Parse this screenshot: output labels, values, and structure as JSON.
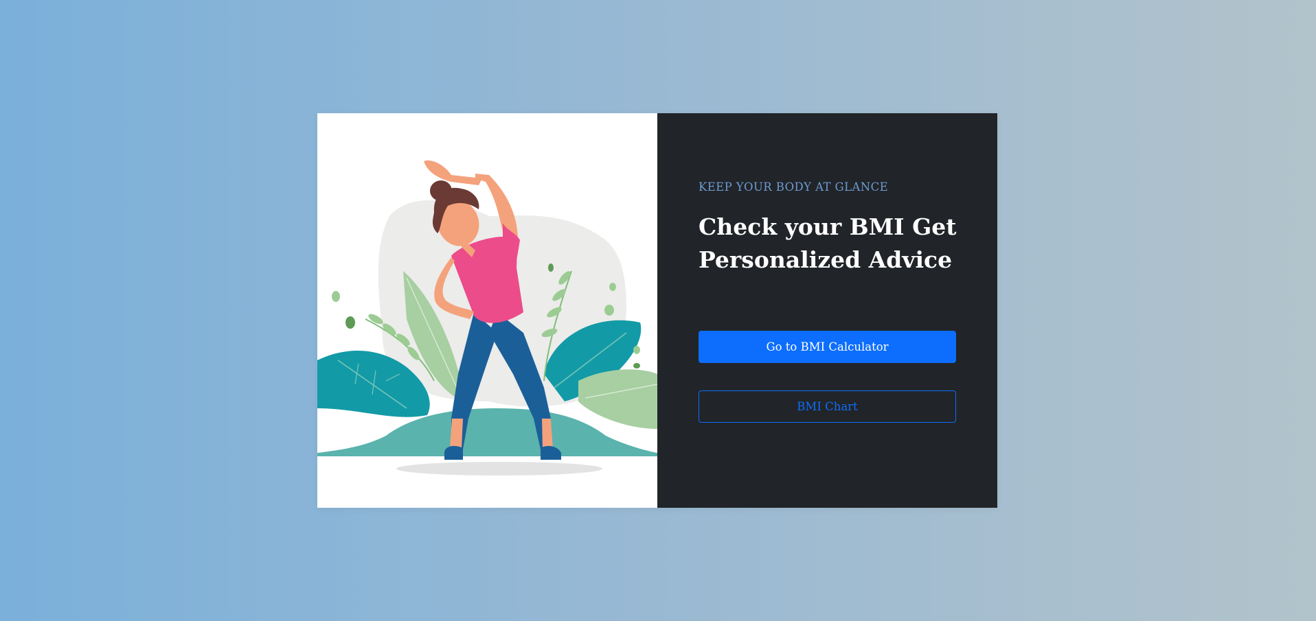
{
  "hero": {
    "eyebrow": "KEEP YOUR BODY AT GLANCE",
    "headline": "Check your BMI Get Personalized Advice",
    "primary_button_label": "Go to BMI Calculator",
    "secondary_button_label": "BMI Chart"
  },
  "illustration": {
    "icon": "woman-stretching-illustration"
  },
  "colors": {
    "page_gradient_start": "#7bb0da",
    "page_gradient_end": "#b2c3cb",
    "content_panel_bg": "#212428",
    "eyebrow_text": "#6d9bd1",
    "primary_accent": "#0d6efd"
  }
}
